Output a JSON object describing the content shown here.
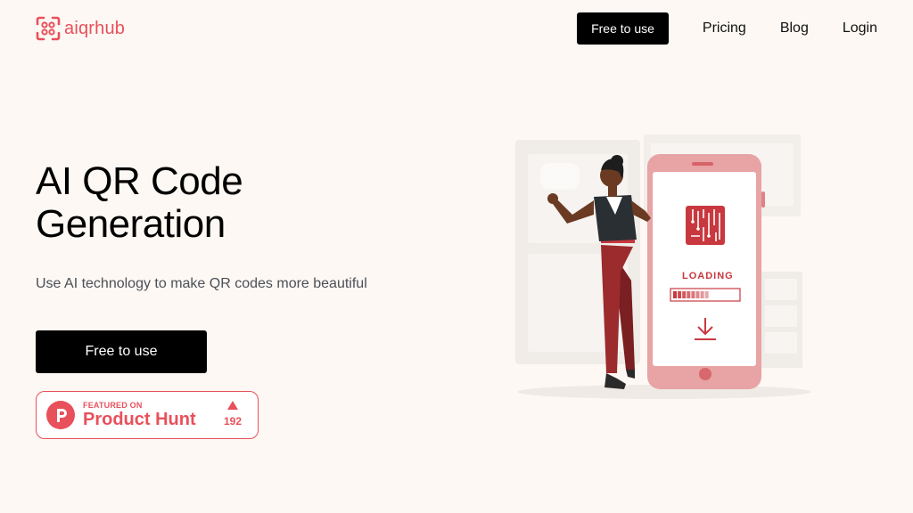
{
  "brand": {
    "name": "aiqrhub",
    "color": "#e8505b"
  },
  "nav": {
    "cta_label": "Free to use",
    "links": [
      "Pricing",
      "Blog",
      "Login"
    ]
  },
  "hero": {
    "title_line1": "AI QR Code",
    "title_line2": "Generation",
    "subtitle": "Use AI technology to make QR codes more beautiful",
    "cta_label": "Free to use"
  },
  "product_hunt": {
    "featured_label": "FEATURED ON",
    "name": "Product Hunt",
    "votes": "192",
    "icon": "product-hunt-p-icon",
    "color": "#e8505b"
  },
  "illustration": {
    "phone_label": "LOADING",
    "progress": 0.55,
    "colors": {
      "accent": "#c9383f",
      "phone": "#e8a3a5",
      "screen": "#ffffff"
    }
  },
  "icons": {
    "logo": "qr-frame-icon",
    "upvote": "upvote-triangle-icon",
    "download": "download-arrow-icon",
    "chip": "circuit-chip-icon"
  }
}
